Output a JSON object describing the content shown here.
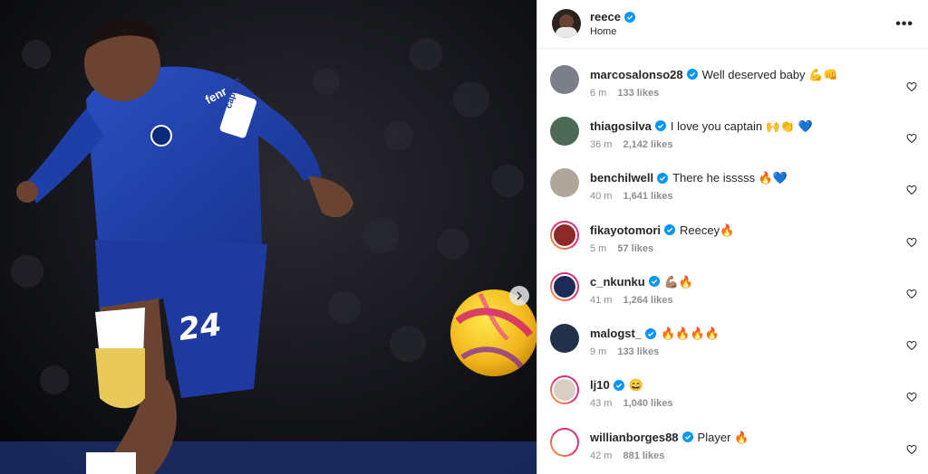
{
  "post": {
    "username": "reece",
    "location": "Home",
    "more_label": "•••",
    "jersey_number": "24",
    "sponsor_text": "fenr",
    "armband_text": "captain"
  },
  "colors": {
    "accent_blue": "#0095f6",
    "kit_blue": "#1f3fa8",
    "verified": "#0095f6",
    "ring_start": "#f9b234",
    "ring_end": "#c13584"
  },
  "icons": {
    "verified": "verified-badge-icon",
    "heart": "heart-outline-icon",
    "more": "more-options-icon",
    "next": "chevron-right-icon"
  },
  "comments": [
    {
      "user": "marcosalonso28",
      "text": "Well deserved baby 💪👊",
      "time": "6 m",
      "likes": "133 likes",
      "ring": false,
      "av": "#7a7f8a"
    },
    {
      "user": "thiagosilva",
      "text": "I love you captain 🙌👏 💙",
      "time": "36 m",
      "likes": "2,142 likes",
      "ring": false,
      "av": "#4c6a54"
    },
    {
      "user": "benchilwell",
      "text": "There he isssss 🔥💙",
      "time": "40 m",
      "likes": "1,641 likes",
      "ring": false,
      "av": "#b0a79b"
    },
    {
      "user": "fikayotomori",
      "text": "Reecey🔥",
      "time": "5 m",
      "likes": "57 likes",
      "ring": true,
      "av": "#8c2a2a"
    },
    {
      "user": "c_nkunku",
      "text": "💪🏽🔥",
      "time": "41 m",
      "likes": "1,264 likes",
      "ring": true,
      "av": "#1c2a55"
    },
    {
      "user": "malogst_",
      "text": "🔥🔥🔥🔥",
      "time": "9 m",
      "likes": "133 likes",
      "ring": false,
      "av": "#22304a"
    },
    {
      "user": "lj10",
      "text": "😄",
      "time": "43 m",
      "likes": "1,040 likes",
      "ring": true,
      "av": "#d8cfc3"
    },
    {
      "user": "willianborges88",
      "text": "Player 🔥",
      "time": "42 m",
      "likes": "881 likes",
      "ring": true,
      "av": "#ffffff"
    }
  ]
}
